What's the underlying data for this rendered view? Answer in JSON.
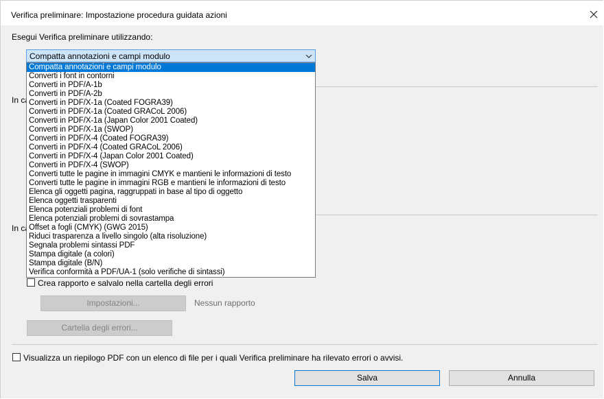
{
  "window": {
    "title": "Verifica preliminare: Impostazione procedura guidata azioni"
  },
  "run_using_label": "Esegui Verifica preliminare utilizzando:",
  "profile_select": {
    "selected": "Compatta annotazioni e campi modulo",
    "options": [
      "Compatta annotazioni e campi modulo",
      "Converti i font in contorni",
      "Converti in PDF/A-1b",
      "Converti in PDF/A-2b",
      "Converti in PDF/X-1a (Coated FOGRA39)",
      "Converti in PDF/X-1a (Coated GRACoL 2006)",
      "Converti in PDF/X-1a (Japan Color 2001 Coated)",
      "Converti in PDF/X-1a (SWOP)",
      "Converti in PDF/X-4 (Coated FOGRA39)",
      "Converti in PDF/X-4 (Coated GRACoL 2006)",
      "Converti in PDF/X-4 (Japan Color 2001 Coated)",
      "Converti in PDF/X-4 (SWOP)",
      "Converti tutte le pagine in immagini CMYK e mantieni le informazioni di testo",
      "Converti tutte le pagine in immagini RGB e mantieni le informazioni di testo",
      "Elenca gli oggetti pagina, raggruppati in base al tipo di oggetto",
      "Elenca oggetti trasparenti",
      "Elenca potenziali problemi di font",
      "Elenca potenziali problemi di sovrastampa",
      "Offset a fogli (CMYK) (GWG 2015)",
      "Riduci trasparenza a livello singolo (alta risoluzione)",
      "Segnala problemi sintassi PDF",
      "Stampa digitale (a colori)",
      "Stampa digitale (B/N)",
      "Verifica conformità a PDF/UA-1 (solo verifiche di sintassi)"
    ]
  },
  "section1_label": "In ca",
  "section2_label": "In ca",
  "create_report": {
    "label": "Crea rapporto e salvalo nella cartella degli errori",
    "checked": false
  },
  "settings_button": "Impostazioni...",
  "no_report_text": "Nessun rapporto",
  "errors_folder_button": "Cartella degli errori...",
  "summary_checkbox": {
    "label": "Visualizza un riepilogo PDF con un elenco di file per i quali Verifica preliminare ha rilevato errori o avvisi.",
    "checked": false
  },
  "buttons": {
    "save": "Salva",
    "cancel": "Annulla"
  },
  "colors": {
    "selection": "#0078d7",
    "combo_highlight": "#cde4f7",
    "dialog_bg": "#f0f0f0"
  }
}
